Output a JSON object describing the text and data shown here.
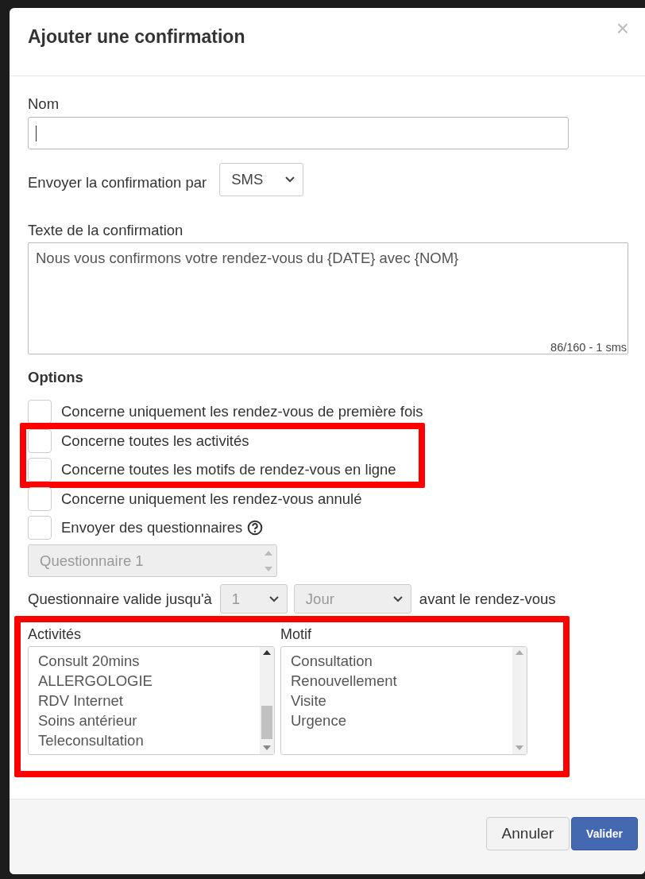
{
  "dialog": {
    "title": "Ajouter une confirmation",
    "close": "×"
  },
  "name_field": {
    "label": "Nom",
    "focused": true
  },
  "send_by": {
    "label": "Envoyer la confirmation par",
    "value": "SMS"
  },
  "message": {
    "label": "Texte de la confirmation",
    "value": "Nous vous confirmons votre rendez-vous du {DATE} avec {NOM}",
    "counter": "86/160 - 1 sms"
  },
  "options": {
    "title": "Options",
    "groups": [
      {
        "highlighted": false,
        "items": [
          {
            "label": "Concerne uniquement les rendez-vous de première fois",
            "checked": false,
            "help": false
          }
        ]
      },
      {
        "highlighted": true,
        "items": [
          {
            "label": "Concerne toutes les activités",
            "checked": false,
            "help": false
          },
          {
            "label": "Concerne toutes les motifs de rendez-vous en ligne",
            "checked": false,
            "help": false
          }
        ]
      },
      {
        "highlighted": false,
        "items": [
          {
            "label": "Concerne uniquement les rendez-vous annulé",
            "checked": false,
            "help": false
          },
          {
            "label": "Envoyer des questionnaires",
            "checked": false,
            "help": true
          }
        ]
      }
    ]
  },
  "questionnaire": {
    "value": "Questionnaire 1",
    "disabled": true
  },
  "validity": {
    "label": "Questionnaire valide jusqu'à",
    "count": {
      "value": "1",
      "disabled": true
    },
    "unit": {
      "value": "Jour",
      "disabled": true
    },
    "suffix": "avant le rendez-vous"
  },
  "lists_section": {
    "highlighted": true,
    "lists": [
      {
        "label": "Activités",
        "scrollable": true,
        "items": [
          {
            "text": "Consult 20mins",
            "selected": false
          },
          {
            "text": "ALLERGOLOGIE",
            "selected": false
          },
          {
            "text": "RDV Internet",
            "selected": false
          },
          {
            "text": "Soins antérieur",
            "selected": false
          },
          {
            "text": "Teleconsultation",
            "selected": false
          }
        ]
      },
      {
        "label": "Motif",
        "scrollable": false,
        "items": [
          {
            "text": "Consultation",
            "selected": false
          },
          {
            "text": "Renouvellement",
            "selected": false
          },
          {
            "text": "Visite",
            "selected": false
          },
          {
            "text": "Urgence",
            "selected": false
          }
        ]
      }
    ]
  },
  "buttons": [
    {
      "label": "Annuler",
      "kind": "default"
    },
    {
      "label": "Valider",
      "kind": "primary"
    }
  ]
}
